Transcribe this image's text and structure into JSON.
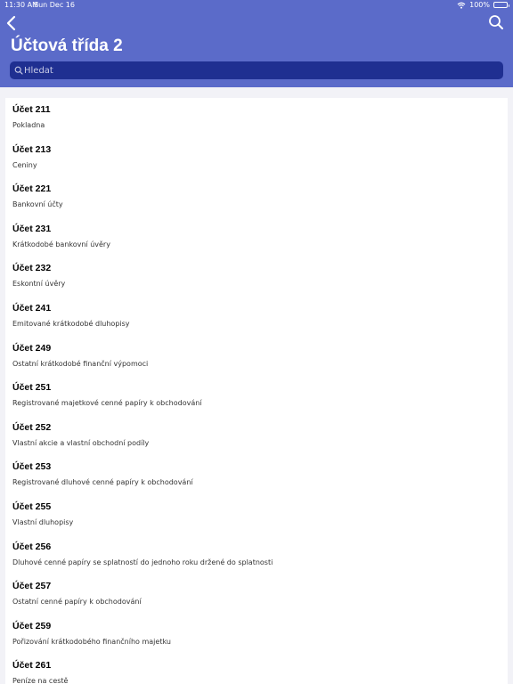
{
  "status": {
    "time": "11:30 AM",
    "date": "Sun Dec 16",
    "battery": "100%"
  },
  "header": {
    "title": "Účtová třída 2"
  },
  "search": {
    "placeholder": "Hledat"
  },
  "accounts": [
    {
      "code": "Účet 211",
      "name": "Pokladna"
    },
    {
      "code": "Účet 213",
      "name": "Ceniny"
    },
    {
      "code": "Účet 221",
      "name": "Bankovní účty"
    },
    {
      "code": "Účet 231",
      "name": "Krátkodobé bankovní úvěry"
    },
    {
      "code": "Účet 232",
      "name": "Eskontní úvěry"
    },
    {
      "code": "Účet 241",
      "name": "Emitované krátkodobé dluhopisy"
    },
    {
      "code": "Účet 249",
      "name": "Ostatní krátkodobé finanční výpomoci"
    },
    {
      "code": "Účet 251",
      "name": "Registrované majetkové cenné papíry k obchodování"
    },
    {
      "code": "Účet 252",
      "name": "Vlastní akcie a vlastní obchodní podíly"
    },
    {
      "code": "Účet 253",
      "name": "Registrované dluhové cenné papíry k obchodování"
    },
    {
      "code": "Účet 255",
      "name": "Vlastní dluhopisy"
    },
    {
      "code": "Účet 256",
      "name": "Dluhové cenné papíry se splatností do jednoho roku držené do splatnosti"
    },
    {
      "code": "Účet 257",
      "name": "Ostatní cenné papíry k obchodování"
    },
    {
      "code": "Účet 259",
      "name": "Pořizování krátkodobého finančního majetku"
    },
    {
      "code": "Účet 261",
      "name": "Peníze na cestě"
    }
  ]
}
